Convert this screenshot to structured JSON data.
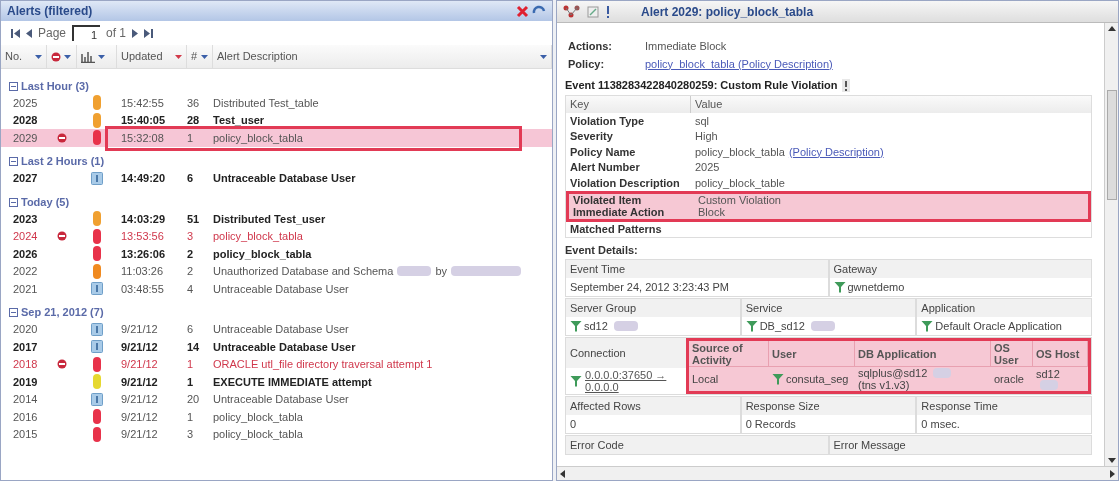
{
  "alerts_panel": {
    "title": "Alerts (filtered)",
    "pager": {
      "label": "Page",
      "page": "1",
      "total": "of 1"
    },
    "columns": [
      {
        "label": "No.",
        "kind": "text",
        "sorted": false
      },
      {
        "kind": "blocked-icon",
        "sorted": false
      },
      {
        "kind": "severity-icon",
        "sorted": false
      },
      {
        "label": "Updated",
        "kind": "text",
        "sorted": true
      },
      {
        "label": "#",
        "kind": "text",
        "sorted": false
      },
      {
        "label": "Alert Description",
        "kind": "text",
        "sorted": false
      }
    ],
    "groups": [
      {
        "label": "Last Hour (3)",
        "expanded": true,
        "rows": [
          {
            "no": "2025",
            "blocked": false,
            "severity": {
              "kind": "bar",
              "color": "#f0a030"
            },
            "updated": "15:42:55",
            "count": "36",
            "description": "Distributed Test_table",
            "kind": "normal",
            "highlighted": false
          },
          {
            "no": "2028",
            "blocked": false,
            "severity": {
              "kind": "bar",
              "color": "#f0a030"
            },
            "updated": "15:40:05",
            "count": "28",
            "description": "Test_user",
            "kind": "bold",
            "highlighted": false
          },
          {
            "no": "2029",
            "blocked": true,
            "severity": {
              "kind": "bar",
              "color": "#e8324a"
            },
            "updated": "15:32:08",
            "count": "1",
            "description": "policy_block_tabla",
            "kind": "normal",
            "highlighted": true
          }
        ]
      },
      {
        "label": "Last 2 Hours (1)",
        "expanded": true,
        "rows": [
          {
            "no": "2027",
            "blocked": false,
            "severity": {
              "kind": "info",
              "color": "#a9cbe8"
            },
            "updated": "14:49:20",
            "count": "6",
            "description": "Untraceable Database User",
            "kind": "bold",
            "highlighted": false
          }
        ]
      },
      {
        "label": "Today (5)",
        "expanded": true,
        "rows": [
          {
            "no": "2023",
            "blocked": false,
            "severity": {
              "kind": "bar",
              "color": "#f0a030"
            },
            "updated": "14:03:29",
            "count": "51",
            "description": "Distributed Test_user",
            "kind": "bold",
            "highlighted": false
          },
          {
            "no": "2024",
            "blocked": true,
            "severity": {
              "kind": "bar",
              "color": "#e8324a"
            },
            "updated": "13:53:56",
            "count": "3",
            "description": "policy_block_tabla",
            "kind": "red",
            "highlighted": false
          },
          {
            "no": "2026",
            "blocked": false,
            "severity": {
              "kind": "bar",
              "color": "#e8324a"
            },
            "updated": "13:26:06",
            "count": "2",
            "description": "policy_block_tabla",
            "kind": "bold",
            "highlighted": false
          },
          {
            "no": "2022",
            "blocked": false,
            "severity": {
              "kind": "bar",
              "color": "#f08a20"
            },
            "updated": "11:03:26",
            "count": "2",
            "description": "Unauthorized Database and Schema",
            "redacted": true,
            "after": "by",
            "kind": "normal",
            "highlighted": false
          },
          {
            "no": "2021",
            "blocked": false,
            "severity": {
              "kind": "info",
              "color": "#a9cbe8"
            },
            "updated": "03:48:55",
            "count": "4",
            "description": "Untraceable Database User",
            "kind": "normal",
            "highlighted": false
          }
        ]
      },
      {
        "label": "Sep 21, 2012 (7)",
        "expanded": true,
        "rows": [
          {
            "no": "2020",
            "blocked": false,
            "severity": {
              "kind": "info",
              "color": "#a9cbe8"
            },
            "updated": "9/21/12",
            "count": "6",
            "description": "Untraceable Database User",
            "kind": "normal",
            "highlighted": false
          },
          {
            "no": "2017",
            "blocked": false,
            "severity": {
              "kind": "info",
              "color": "#a9cbe8"
            },
            "updated": "9/21/12",
            "count": "14",
            "description": "Untraceable Database User",
            "kind": "bold",
            "highlighted": false
          },
          {
            "no": "2018",
            "blocked": true,
            "severity": {
              "kind": "bar",
              "color": "#e8324a"
            },
            "updated": "9/21/12",
            "count": "1",
            "description": "ORACLE utl_file directory traversal attempt 1",
            "kind": "red",
            "highlighted": false
          },
          {
            "no": "2019",
            "blocked": false,
            "severity": {
              "kind": "bar",
              "color": "#e6d830"
            },
            "updated": "9/21/12",
            "count": "1",
            "description": "EXECUTE IMMEDIATE attempt",
            "kind": "bold",
            "highlighted": false
          },
          {
            "no": "2014",
            "blocked": false,
            "severity": {
              "kind": "info",
              "color": "#a9cbe8"
            },
            "updated": "9/21/12",
            "count": "20",
            "description": "Untraceable Database User",
            "kind": "normal",
            "highlighted": false
          },
          {
            "no": "2016",
            "blocked": false,
            "severity": {
              "kind": "bar",
              "color": "#e8324a"
            },
            "updated": "9/21/12",
            "count": "1",
            "description": "policy_block_tabla",
            "kind": "normal",
            "highlighted": false
          },
          {
            "no": "2015",
            "blocked": false,
            "severity": {
              "kind": "bar",
              "color": "#e8324a"
            },
            "updated": "9/21/12",
            "count": "3",
            "description": "policy_block_tabla",
            "kind": "normal",
            "highlighted": false
          }
        ]
      }
    ]
  },
  "alert_detail": {
    "title": "Alert 2029: policy_block_tabla",
    "summary": [
      {
        "label": "Actions:",
        "value": "Immediate Block",
        "kind": "text"
      },
      {
        "label": "Policy:",
        "value": "policy_block_tabla (Policy Description)",
        "kind": "link"
      }
    ],
    "event_heading": "Event 1138283422840280259: Custom Rule Violation",
    "key_value": {
      "columns": [
        "Key",
        "Value"
      ],
      "rows": [
        {
          "key": "Violation Type",
          "value": "sql",
          "highlighted": false
        },
        {
          "key": "Severity",
          "value": "High",
          "highlighted": false
        },
        {
          "key": "Policy Name",
          "value": "policy_block_tabla",
          "link": "(Policy Description)",
          "highlighted": false
        },
        {
          "key": "Alert Number",
          "value": "2025",
          "highlighted": false
        },
        {
          "key": "Violation Description",
          "value": "policy_block_table",
          "highlighted": false
        },
        {
          "key": "Violated Item",
          "value": "Custom Violation",
          "highlighted": true
        },
        {
          "key": "Immediate Action",
          "value": "Block",
          "highlighted": true
        },
        {
          "key": "Matched Patterns",
          "highlighted": false
        }
      ]
    },
    "event_details": {
      "title": "Event Details:",
      "rows": [
        [
          {
            "label": "Event Time",
            "value": "September 24, 2012 3:23:43 PM",
            "funnel": false
          },
          {
            "label": "Gateway",
            "value": "gwnetdemo",
            "funnel": true
          }
        ],
        [
          {
            "label": "Server Group",
            "value": "sd12",
            "funnel": true,
            "redacted": true
          },
          {
            "label": "Service",
            "value": "DB_sd12",
            "funnel": true,
            "redacted": true
          },
          {
            "label": "Application",
            "value": "Default Oracle Application",
            "funnel": true
          }
        ]
      ],
      "connection": {
        "label": "Connection",
        "lines": [
          "0.0.0.0:37650 →",
          "0.0.0.0"
        ],
        "activity": {
          "highlighted": true,
          "columns": [
            "Source of Activity",
            "User",
            "DB Application",
            "OS User",
            "OS Host"
          ],
          "values": [
            {
              "text": "Local"
            },
            {
              "text": "consuta_seg",
              "funnel": true
            },
            {
              "text": "sqlplus@sd12",
              "redacted": true,
              "after": "(tns v1.v3)"
            },
            {
              "text": "oracle"
            },
            {
              "text": "sd12",
              "redacted": true
            }
          ]
        }
      },
      "metrics": [
        {
          "label": "Affected Rows",
          "value": "0"
        },
        {
          "label": "Response Size",
          "value": "0 Records"
        },
        {
          "label": "Response Time",
          "value": "0 msec."
        }
      ],
      "errors": [
        {
          "label": "Error Code"
        },
        {
          "label": "Error Message"
        }
      ]
    }
  }
}
